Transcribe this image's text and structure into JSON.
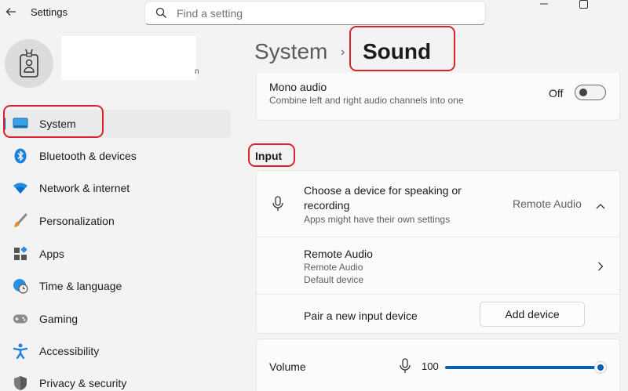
{
  "window": {
    "app_title": "Settings",
    "back_icon": "back-arrow-icon",
    "minimize_glyph": "—",
    "maximize_glyph": "☐"
  },
  "search": {
    "placeholder": "Find a setting"
  },
  "profile": {
    "email_fragment": "n"
  },
  "sidebar": {
    "items": [
      {
        "label": "System",
        "icon": "monitor-icon",
        "active": true
      },
      {
        "label": "Bluetooth & devices",
        "icon": "bluetooth-icon"
      },
      {
        "label": "Network & internet",
        "icon": "wifi-icon"
      },
      {
        "label": "Personalization",
        "icon": "brush-icon"
      },
      {
        "label": "Apps",
        "icon": "apps-icon"
      },
      {
        "label": "Time & language",
        "icon": "globe-clock-icon"
      },
      {
        "label": "Gaming",
        "icon": "gamepad-icon"
      },
      {
        "label": "Accessibility",
        "icon": "accessibility-icon"
      },
      {
        "label": "Privacy & security",
        "icon": "shield-icon"
      }
    ]
  },
  "breadcrumb": {
    "parent": "System",
    "separator": "›",
    "current": "Sound"
  },
  "mono_audio": {
    "title": "Mono audio",
    "description": "Combine left and right audio channels into one",
    "state": "Off"
  },
  "input_section": {
    "label": "Input",
    "choose_device": {
      "title_line1": "Choose a device for speaking or",
      "title_line2": "recording",
      "description": "Apps might have their own settings",
      "selected": "Remote Audio"
    },
    "device": {
      "name": "Remote Audio",
      "subtitle": "Remote Audio",
      "status": "Default device"
    },
    "pair": {
      "title": "Pair a new input device",
      "button": "Add device"
    }
  },
  "volume": {
    "label": "Volume",
    "value": "100",
    "level_percent": 100
  },
  "colors": {
    "accent": "#005fb8",
    "annotation": "#d9232d"
  }
}
